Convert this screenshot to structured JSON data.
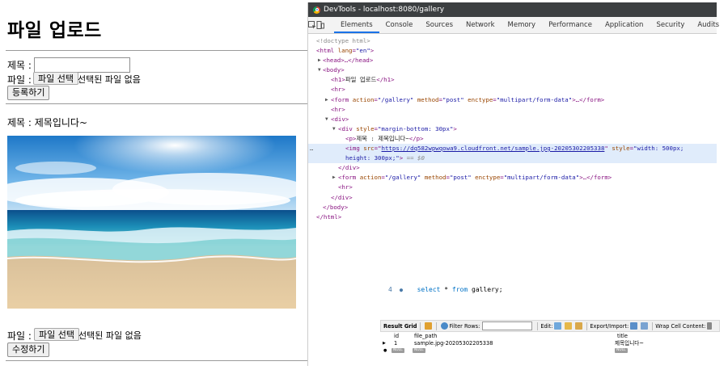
{
  "page": {
    "heading": "파일 업로드",
    "upload_form": {
      "title_label": "제목 :",
      "title_value": "",
      "file_label": "파일 :",
      "file_button": "파일 선택",
      "file_status": "선택된 파일 없음",
      "submit": "등록하기"
    },
    "post": {
      "title_text": "제목 : 제목입니다~"
    },
    "edit_form": {
      "file_label": "파일 :",
      "file_button": "파일 선택",
      "file_status": "선택된 파일 없음",
      "submit": "수정하기"
    }
  },
  "devtools": {
    "window_title": "DevTools - localhost:8080/gallery",
    "tabs": [
      "Elements",
      "Console",
      "Sources",
      "Network",
      "Memory",
      "Performance",
      "Application",
      "Security",
      "Audits"
    ],
    "active_tab": "Elements",
    "dom": {
      "doctype": "<!doctype html>",
      "html_open_tag": "<html",
      "html_lang_attr": "lang",
      "html_lang_val": "\"en\"",
      "head": "<head>…</head>",
      "body_open": "<body>",
      "h1_open": "<h1>",
      "h1_text": "파일 업로드",
      "h1_close": "</h1>",
      "hr": "<hr>",
      "form_tag": "<form",
      "form_action_attr": "action",
      "form_action_val": "\"/gallery\"",
      "form_method_attr": "method",
      "form_method_val": "\"post\"",
      "form_enctype_attr": "enctype",
      "form_enctype_val": "\"multipart/form-data\"",
      "form_close": ">…</form>",
      "div_open": "<div>",
      "div_style_tag": "<div",
      "div_style_attr": "style",
      "div_style_val": "\"margin-bottom: 30px\"",
      "p_open": "<p>",
      "p_text": "제목 : 제목입니다~",
      "p_close": "</p>",
      "img_tag": "<img",
      "img_src_attr": "src",
      "img_src_val": "https://dq582wpwqowa9.cloudfront.net/sample.jpg-20205302205338",
      "img_style_attr": "style",
      "img_style_val_1": "\"width: 500px;",
      "img_style_val_2": "height: 300px;\"",
      "img_eq": "== $0",
      "div_close": "</div>",
      "body_close": "</body>",
      "html_close": "</html>"
    }
  },
  "sql_editor": {
    "line_number": "4",
    "query_kw1": "select",
    "query_rest1": " * ",
    "query_kw2": "from",
    "query_rest2": " gallery;"
  },
  "result_grid": {
    "label": "Result Grid",
    "filter_label": "Filter Rows:",
    "filter_value": "",
    "edit_label": "Edit:",
    "export_label": "Export/Import:",
    "wrap_label": "Wrap Cell Content:",
    "columns": [
      "id",
      "file_path",
      "title"
    ],
    "rows": [
      {
        "id": "1",
        "file_path": "sample.jpg-20205302205338",
        "title": "제목입니다~"
      }
    ],
    "null_label": "NULL"
  }
}
